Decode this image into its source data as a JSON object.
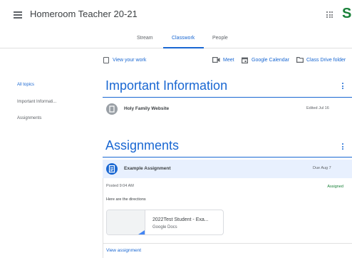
{
  "header": {
    "app_title": "Homeroom Teacher 20-21",
    "avatar_letter": "S",
    "avatar_color": "#188038"
  },
  "tabs": [
    {
      "label": "Stream",
      "active": false
    },
    {
      "label": "Classwork",
      "active": true
    },
    {
      "label": "People",
      "active": false
    }
  ],
  "actions": {
    "view_your_work": "View your work",
    "meet": "Meet",
    "google_calendar": "Google Calendar",
    "class_drive_folder": "Class Drive folder"
  },
  "sidebar": {
    "items": [
      {
        "label": "All topics",
        "active": true
      },
      {
        "label": "Important Informati...",
        "active": false
      },
      {
        "label": "Assignments",
        "active": false
      }
    ]
  },
  "topics": {
    "important": {
      "title": "Important Information",
      "material_title": "Holy Family Website",
      "material_meta": "Edited Jul 16"
    },
    "assignments": {
      "title": "Assignments",
      "assignment_title": "Example Assignment",
      "assignment_due": "Due Aug 7",
      "posted": "Posted 9:04 AM",
      "status": "Assigned",
      "directions": "Here are the directions",
      "attachment_title": "2022Test Student - Exa...",
      "attachment_type": "Google Docs",
      "view_link": "View assignment"
    }
  },
  "colors": {
    "accent": "#1967d2",
    "assigned_green": "#188038",
    "assignment_row_bg": "#e8f0fe"
  },
  "icons": [
    "menu-icon",
    "apps-grid-icon",
    "assignment-work-icon",
    "video-camera-icon",
    "calendar-icon",
    "folder-icon",
    "material-icon",
    "assignment-icon",
    "more-vert-icon"
  ]
}
